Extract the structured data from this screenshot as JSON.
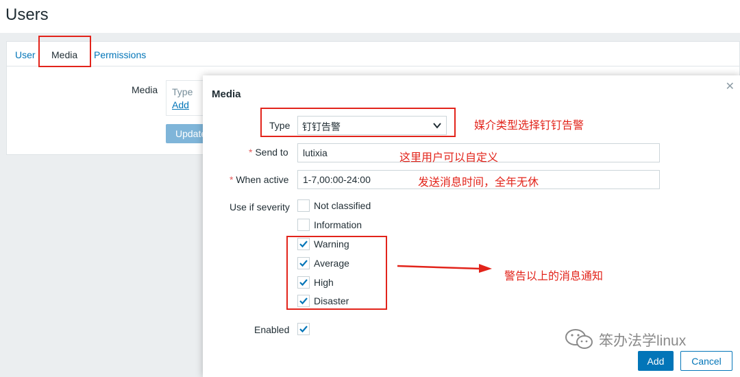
{
  "page": {
    "title": "Users"
  },
  "tabs": [
    {
      "label": "User"
    },
    {
      "label": "Media"
    },
    {
      "label": "Permissions"
    }
  ],
  "background_form": {
    "media_label": "Media",
    "type_header": "Type",
    "add_link": "Add",
    "update_button": "Update"
  },
  "dialog": {
    "title": "Media",
    "close_icon": "close-icon",
    "type_label": "Type",
    "type_value": "钉钉告警",
    "send_to_label": "Send to",
    "send_to_value": "lutixia",
    "when_active_label": "When active",
    "when_active_value": "1-7,00:00-24:00",
    "severity_label": "Use if severity",
    "severities": [
      {
        "label": "Not classified",
        "checked": false
      },
      {
        "label": "Information",
        "checked": false
      },
      {
        "label": "Warning",
        "checked": true
      },
      {
        "label": "Average",
        "checked": true
      },
      {
        "label": "High",
        "checked": true
      },
      {
        "label": "Disaster",
        "checked": true
      }
    ],
    "enabled_label": "Enabled",
    "enabled_checked": true,
    "add_button": "Add",
    "cancel_button": "Cancel"
  },
  "annotations": {
    "type_note": "媒介类型选择钉钉告警",
    "send_to_note": "这里用户可以自定义",
    "when_active_note": "发送消息时间，全年无休",
    "severity_note": "警告以上的消息通知"
  },
  "watermark": {
    "text": "笨办法学linux"
  },
  "colors": {
    "accent": "#0275b8",
    "annotation_red": "#e2231a",
    "required_star": "#e45959"
  }
}
